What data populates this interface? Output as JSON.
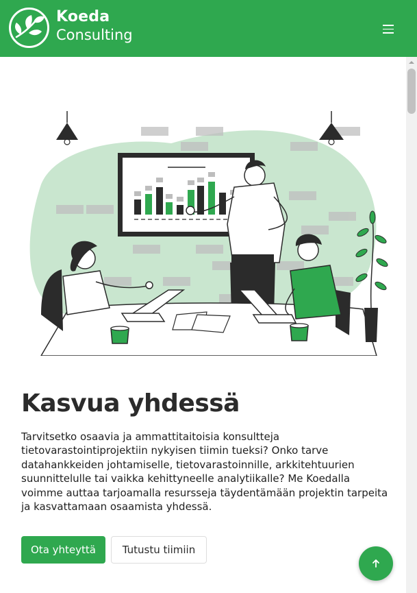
{
  "brand": {
    "name": "Koeda",
    "sub": "Consulting",
    "color": "#2fa84f"
  },
  "nav": {
    "menu_icon": "hamburger-menu-icon"
  },
  "hero": {
    "title": "Kasvua yhdessä",
    "text": "Tarvitsetko osaavia ja ammattitaitoisia konsultteja tietovarastointiprojektiin nykyisen tiimin tueksi? Onko tarve datahankkeiden johtamiselle, tietovarastoinnille, arkkitehtuurien suunnittelulle tai vaikka kehittyneelle analytiikalle? Me Koedalla voimme auttaa tarjoamalla resursseja täydentämään projektin tarpeita ja kasvattamaan osaamista yhdessä.",
    "primary_button": "Ota yhteyttä",
    "secondary_button": "Tutustu tiimiin"
  },
  "illustration": {
    "subject": "team-meeting-illustration",
    "accent": "#2fa84f",
    "blob": "#c9e6cf"
  },
  "back_to_top": {
    "icon": "arrow-up-icon"
  }
}
